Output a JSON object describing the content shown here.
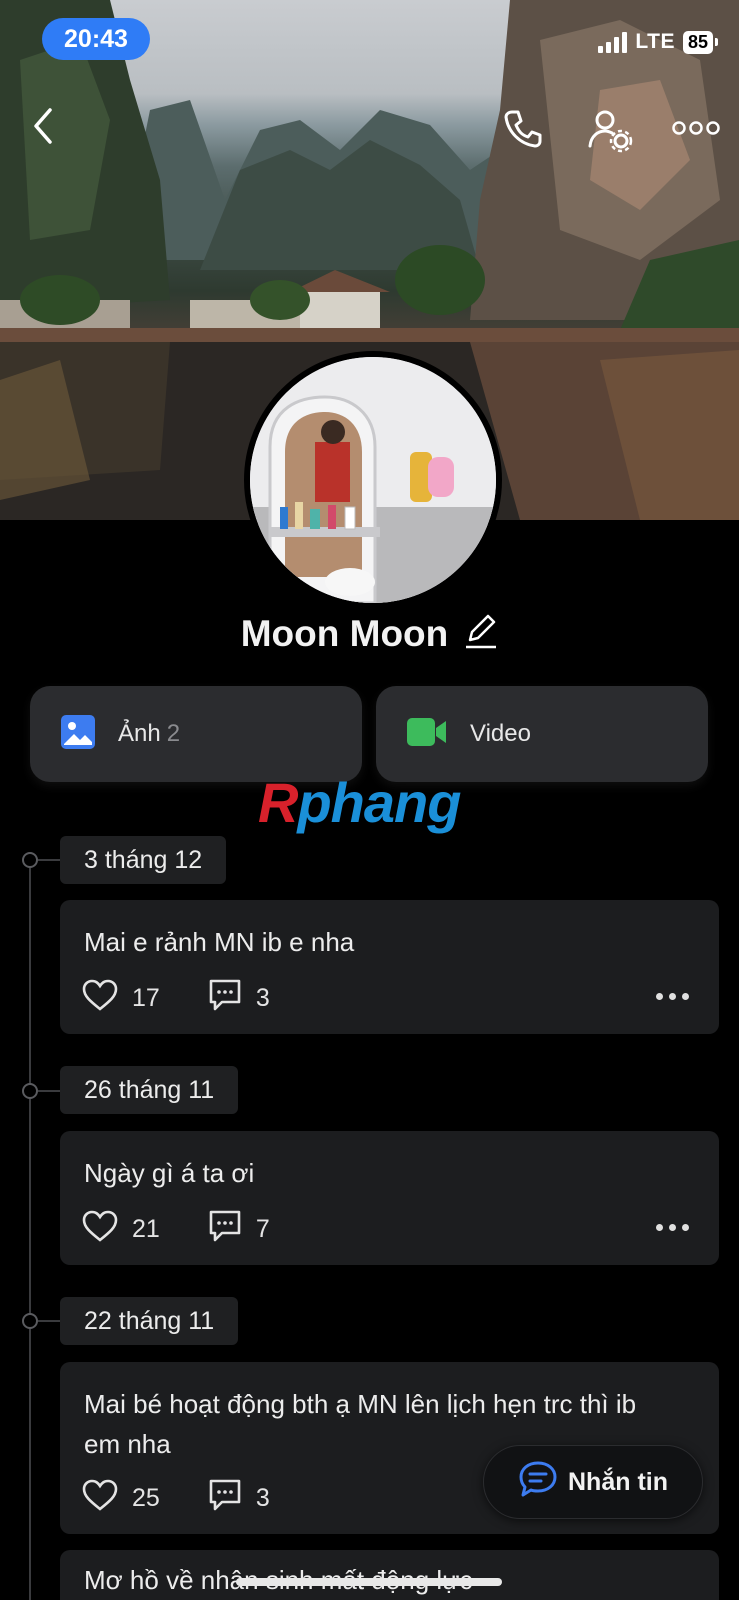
{
  "status_bar": {
    "time": "20:43",
    "network": "LTE",
    "battery": "85"
  },
  "top_bar": {
    "back_icon": "chevron-left-icon",
    "call_icon": "phone-icon",
    "settings_icon": "user-settings-icon",
    "more_icon": "more-horizontal-icon"
  },
  "profile": {
    "name": "Moon Moon",
    "edit_icon": "pencil-icon"
  },
  "media": {
    "photos": {
      "label": "Ảnh",
      "count": "2",
      "icon": "image-icon"
    },
    "videos": {
      "label": "Video",
      "icon": "video-camera-icon"
    }
  },
  "watermark": {
    "first": "R",
    "rest": "phang"
  },
  "timeline": [
    {
      "date": "3 tháng 12",
      "text": "Mai e rảnh MN ib e nha",
      "likes": "17",
      "comments": "3"
    },
    {
      "date": "26 tháng 11",
      "text": "Ngày gì á ta ơi",
      "likes": "21",
      "comments": "7"
    },
    {
      "date": "22 tháng 11",
      "text": "Mai bé hoạt động bth ạ MN lên lịch hẹn trc thì ib em nha",
      "likes": "25",
      "comments": "3"
    },
    {
      "text": "Mơ hồ về nhân sinh mất động lực"
    }
  ],
  "message_button": {
    "label": "Nhắn tin",
    "icon": "chat-bubble-icon"
  },
  "colors": {
    "accent": "#2f7cf6",
    "photo_icon": "#3d7cf0",
    "video_icon": "#3dbb5c",
    "background": "#000000"
  }
}
